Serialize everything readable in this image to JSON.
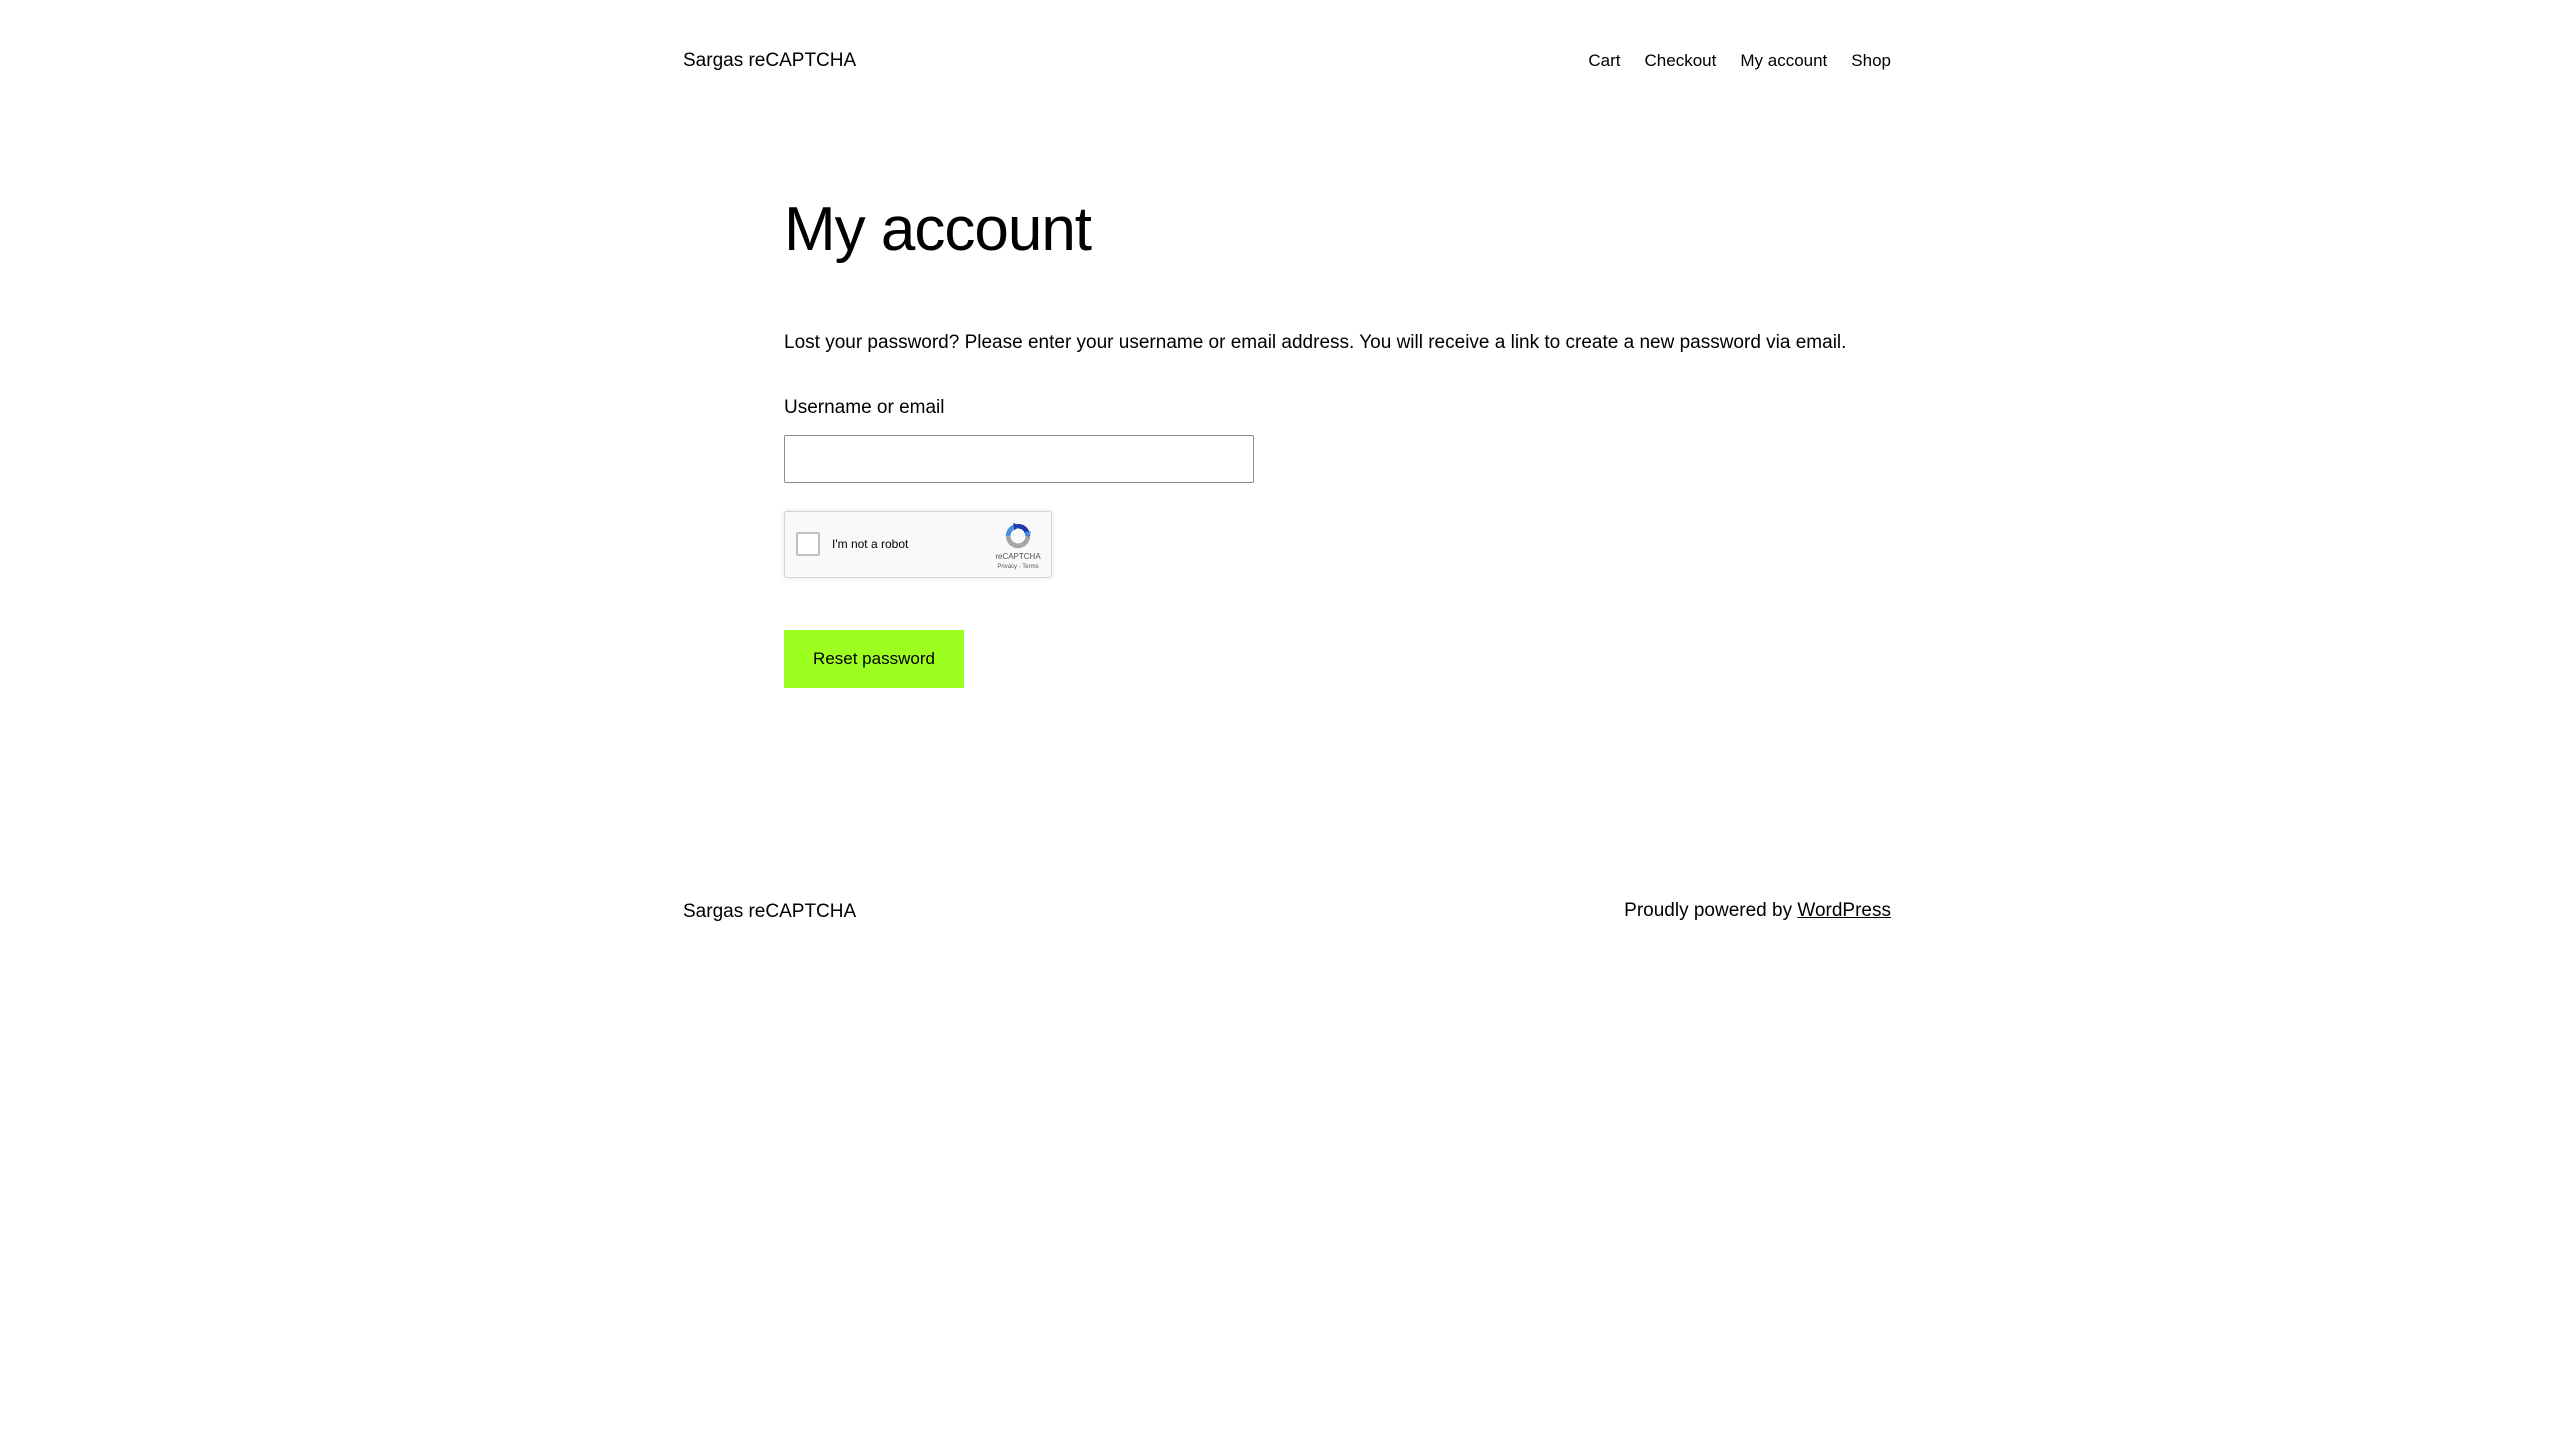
{
  "header": {
    "site_title": "Sargas reCAPTCHA",
    "nav": [
      "Cart",
      "Checkout",
      "My account",
      "Shop"
    ]
  },
  "main": {
    "heading": "My account",
    "intro": "Lost your password? Please enter your username or email address. You will receive a link to create a new password via email.",
    "field_label": "Username or email",
    "field_value": "",
    "recaptcha": {
      "label": "I'm not a robot",
      "brand": "reCAPTCHA",
      "privacy": "Privacy",
      "separator": " - ",
      "terms": "Terms",
      "icon": "recaptcha-logo-icon"
    },
    "button_label": "Reset password"
  },
  "footer": {
    "site_title": "Sargas reCAPTCHA",
    "credit_prefix": "Proudly powered by ",
    "credit_link": "WordPress"
  },
  "colors": {
    "button_bg": "#9dff20",
    "text": "#000000",
    "background": "#ffffff"
  }
}
